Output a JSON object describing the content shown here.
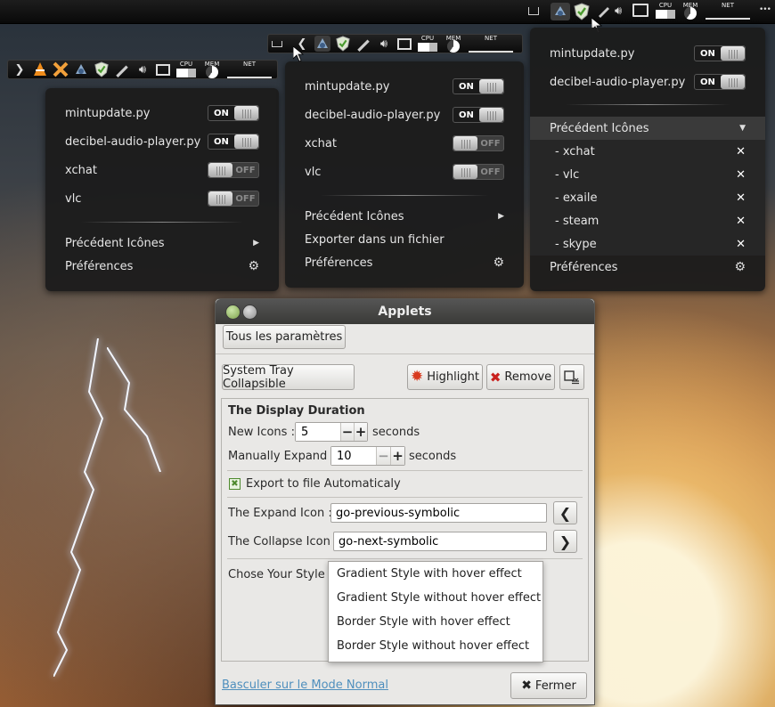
{
  "top_panel": {
    "monitor_cpu": "CPU",
    "monitor_mem": "MEM",
    "monitor_net": "NET",
    "menu_glyph": "•••"
  },
  "menu_left": {
    "items": [
      {
        "label": "mintupdate.py",
        "state": "ON"
      },
      {
        "label": "decibel-audio-player.py",
        "state": "ON"
      },
      {
        "label": "xchat",
        "state": "OFF"
      },
      {
        "label": "vlc",
        "state": "OFF"
      }
    ],
    "previous_icons": "Précédent Icônes",
    "preferences": "Préférences"
  },
  "menu_middle": {
    "items": [
      {
        "label": "mintupdate.py",
        "state": "ON"
      },
      {
        "label": "decibel-audio-player.py",
        "state": "ON"
      },
      {
        "label": "xchat",
        "state": "OFF"
      },
      {
        "label": "vlc",
        "state": "OFF"
      }
    ],
    "previous_icons": "Précédent Icônes",
    "export": "Exporter dans un fichier",
    "preferences": "Préférences"
  },
  "menu_right": {
    "items": [
      {
        "label": "mintupdate.py",
        "state": "ON"
      },
      {
        "label": "decibel-audio-player.py",
        "state": "ON"
      }
    ],
    "previous_icons": "Précédent Icônes",
    "previous_list": [
      "- xchat",
      "- vlc",
      "- exaile",
      "- steam",
      "- skype"
    ],
    "preferences": "Préférences"
  },
  "dialog": {
    "title": "Applets",
    "all_settings": "Tous les paramètres",
    "applet_name": "System Tray Collapsible",
    "highlight": "Highlight",
    "remove": "Remove",
    "section_title": "The Display Duration",
    "new_icons_label": "New Icons :",
    "new_icons_value": "5",
    "seconds1": "seconds",
    "manually_expand_label": "Manually Expand :",
    "manually_expand_value": "10",
    "seconds2": "seconds",
    "export_label": "Export to file Automaticaly",
    "expand_icon_label": "The Expand Icon :",
    "expand_icon_value": "go-previous-symbolic",
    "collapse_icon_label": "The Collapse Icon :",
    "collapse_icon_value": "go-next-symbolic",
    "style_label": "Chose Your Style :",
    "style_options": [
      "Gradient Style with hover effect",
      "Gradient Style without hover effect",
      "Border Style with hover effect",
      "Border Style without hover effect"
    ],
    "normal_mode_link": "Basculer sur le Mode Normal",
    "close": "Fermer"
  },
  "colors": {
    "menu_bg": "#1c1c1c",
    "dialog_bg": "#e9e8e6",
    "link": "#4f8fbd",
    "titlebar": "#3a3a37"
  }
}
